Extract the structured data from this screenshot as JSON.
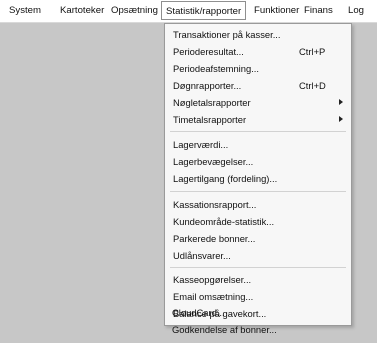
{
  "menubar": {
    "items": [
      {
        "label": "System"
      },
      {
        "label": "Kartoteker"
      },
      {
        "label": "Opsætning"
      },
      {
        "label": "Statistik/rapporter"
      },
      {
        "label": "Funktioner"
      },
      {
        "label": "Finans"
      },
      {
        "label": "Log"
      }
    ]
  },
  "menu": {
    "items": [
      {
        "label": "Transaktioner på kasser...",
        "shortcut": "",
        "submenu": false
      },
      {
        "label": "Perioderesultat...",
        "shortcut": "Ctrl+P",
        "submenu": false
      },
      {
        "label": "Periodeafstemning...",
        "shortcut": "",
        "submenu": false
      },
      {
        "label": "Døgnrapporter...",
        "shortcut": "Ctrl+D",
        "submenu": false
      },
      {
        "label": "Nøgletalsrapporter",
        "shortcut": "",
        "submenu": true
      },
      {
        "label": "Timetalsrapporter",
        "shortcut": "",
        "submenu": true
      },
      {
        "label": "Lagerværdi...",
        "shortcut": "",
        "submenu": false
      },
      {
        "label": "Lagerbevægelser...",
        "shortcut": "",
        "submenu": false
      },
      {
        "label": "Lagertilgang (fordeling)...",
        "shortcut": "",
        "submenu": false
      },
      {
        "label": "Kassationsrapport...",
        "shortcut": "",
        "submenu": false
      },
      {
        "label": "Kundeområde-statistik...",
        "shortcut": "",
        "submenu": false
      },
      {
        "label": "Parkerede bonner...",
        "shortcut": "",
        "submenu": false
      },
      {
        "label": "Udlånsvarer...",
        "shortcut": "",
        "submenu": false
      },
      {
        "label": "Kasseopgørelser...",
        "shortcut": "",
        "submenu": false
      },
      {
        "label": "Email omsætning...",
        "shortcut": "",
        "submenu": false
      },
      {
        "label": "CloudCard...",
        "shortcut": "",
        "submenu": false
      },
      {
        "label": "Godkendelse af bonner...",
        "shortcut": "",
        "submenu": false
      },
      {
        "label": "Balance på gavekort...",
        "shortcut": "",
        "submenu": false
      }
    ]
  }
}
